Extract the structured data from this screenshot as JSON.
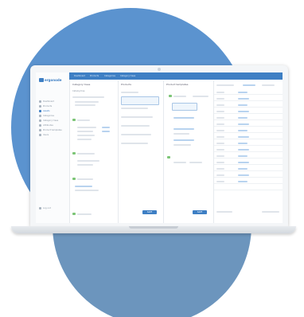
{
  "colors": {
    "circle_light": "#5b93cf",
    "circle_dark": "#6c95bd",
    "brand": "#3e7fc4",
    "accent_green": "#7cc576"
  },
  "app": {
    "logo_text": "ergonode",
    "sidebar": [
      "Dashboard",
      "Products",
      "Assets",
      "Categories",
      "Category trees",
      "Attributes",
      "Product templates",
      "Users"
    ],
    "sidebar_footer": "Log out",
    "topbar": [
      "Dashboard",
      "Products",
      "Categories",
      "Category trees"
    ],
    "columns": [
      {
        "title": "Category trees",
        "subtitle": "Catalog tree"
      },
      {
        "title": "Products",
        "subtitle": ""
      },
      {
        "title": "Product templates",
        "subtitle": ""
      },
      {
        "title": "",
        "subtitle": ""
      }
    ],
    "save_label": "SAVE"
  }
}
